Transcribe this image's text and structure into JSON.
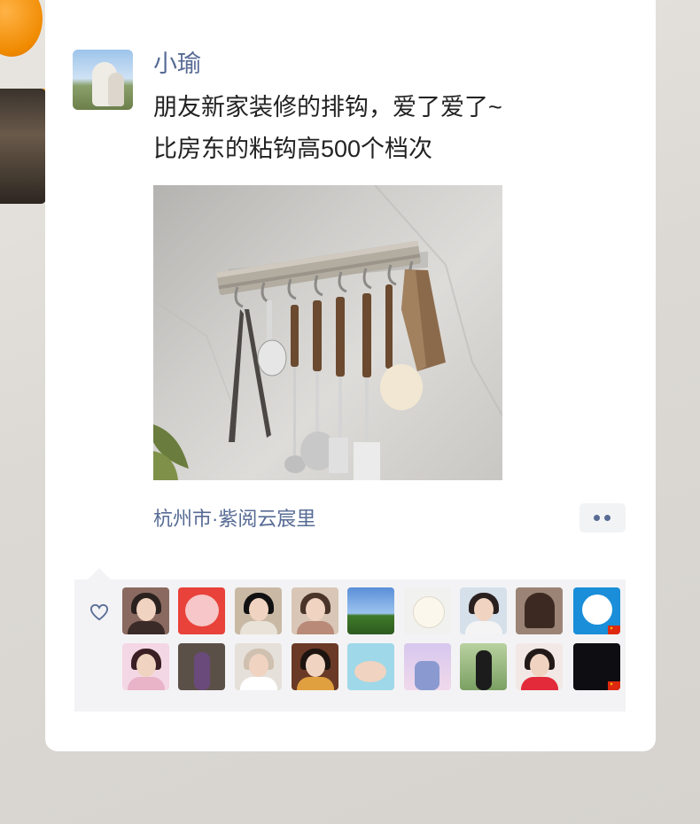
{
  "post": {
    "username": "小瑜",
    "text_line1": "朋友新家装修的排钩，爱了爱了~",
    "text_line2": "比房东的粘钩高500个档次",
    "location": "杭州市·紫阅云宸里"
  },
  "likes": {
    "icon": "heart-outline-icon",
    "count_shown": 18
  },
  "colors": {
    "link_blue": "#576b95",
    "text_dark": "#222222",
    "likes_bg": "#f3f3f5"
  }
}
